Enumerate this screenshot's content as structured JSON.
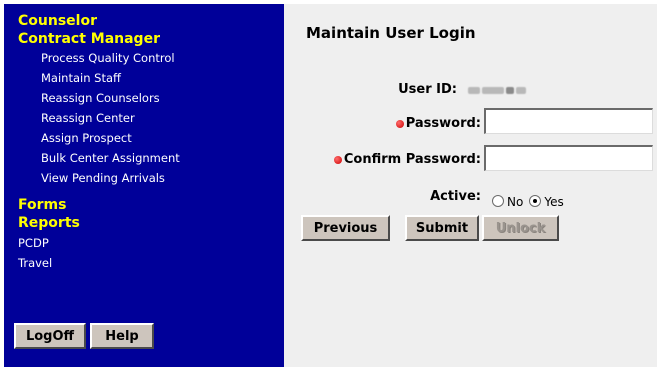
{
  "sidebar": {
    "sections": [
      {
        "label": "Counselor"
      },
      {
        "label": "Contract Manager"
      }
    ],
    "contract_items": [
      {
        "label": "Process Quality Control"
      },
      {
        "label": "Maintain Staff"
      },
      {
        "label": "Reassign Counselors"
      },
      {
        "label": "Reassign Center"
      },
      {
        "label": "Assign Prospect"
      },
      {
        "label": "Bulk Center Assignment"
      },
      {
        "label": "View Pending Arrivals"
      }
    ],
    "forms_label": "Forms",
    "reports_label": "Reports",
    "report_items": [
      {
        "label": "PCDP"
      },
      {
        "label": "Travel"
      }
    ],
    "logoff_label": "LogOff",
    "help_label": "Help"
  },
  "main": {
    "title": "Maintain User Login",
    "user_id_label": "User ID:",
    "password_label": "Password:",
    "password_value": "",
    "confirm_label": "Confirm Password:",
    "confirm_value": "",
    "active_label": "Active:",
    "active_options": [
      {
        "label": "No",
        "checked": false
      },
      {
        "label": "Yes",
        "checked": true
      }
    ],
    "buttons": {
      "previous": "Previous",
      "submit": "Submit",
      "unlock": "Unlock"
    }
  },
  "colors": {
    "sidebar_bg": "#000099",
    "section_heading": "#ffff00",
    "main_bg": "#efefef",
    "required_dot": "#cc0000"
  }
}
